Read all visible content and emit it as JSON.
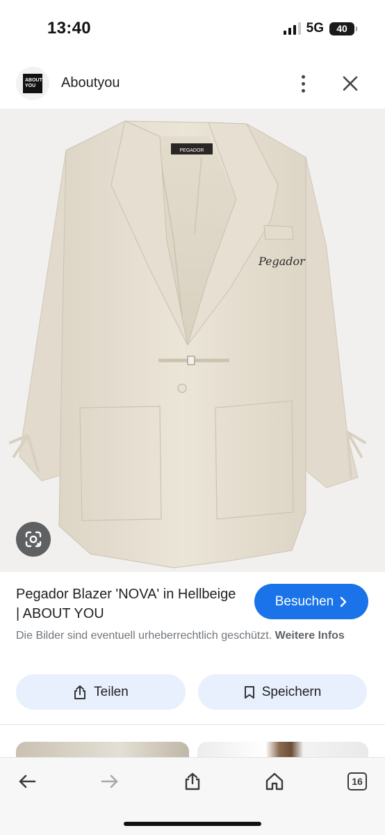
{
  "status_bar": {
    "time": "13:40",
    "network": "5G",
    "battery": "40",
    "icons": [
      "signal-icon",
      "battery-icon"
    ]
  },
  "header": {
    "site_name": "Aboutyou",
    "logo_text_line1": "ABOUT",
    "logo_text_line2": "YOU",
    "icons": [
      "more-vert-icon",
      "close-icon"
    ]
  },
  "image": {
    "brand_tag": "PEGADOR",
    "embroidery": "Pegador",
    "icons": [
      "google-lens-icon"
    ]
  },
  "product": {
    "title": "Pegador Blazer 'NOVA' in Hellbeige | ABOUT YOU",
    "visit_label": "Besuchen",
    "copyright_text": "Die Bilder sind eventuell urheberrechtlich geschützt.",
    "more_info_link": "Weitere Infos"
  },
  "actions": {
    "share_label": "Teilen",
    "save_label": "Speichern",
    "icons": [
      "share-icon",
      "bookmark-icon"
    ]
  },
  "toolbar": {
    "tab_count": "16",
    "icons": [
      "back-arrow-icon",
      "forward-arrow-icon",
      "share-icon",
      "home-icon",
      "tabs-icon"
    ]
  },
  "colors": {
    "accent": "#1a73e8",
    "chip_bg": "#e8f0fe",
    "blazer": "#e8e1d3"
  }
}
